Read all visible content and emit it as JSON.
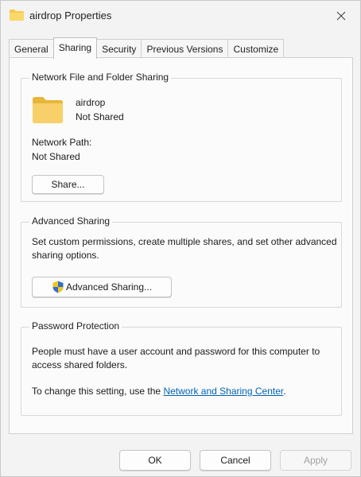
{
  "window": {
    "title": "airdrop Properties"
  },
  "tabs": [
    {
      "label": "General",
      "active": false
    },
    {
      "label": "Sharing",
      "active": true
    },
    {
      "label": "Security",
      "active": false
    },
    {
      "label": "Previous Versions",
      "active": false
    },
    {
      "label": "Customize",
      "active": false
    }
  ],
  "network_sharing": {
    "group_label": "Network File and Folder Sharing",
    "folder_name": "airdrop",
    "status": "Not Shared",
    "network_path_label": "Network Path:",
    "network_path_value": "Not Shared",
    "share_button": "Share..."
  },
  "advanced_sharing": {
    "group_label": "Advanced Sharing",
    "description": "Set custom permissions, create multiple shares, and set other advanced sharing options.",
    "button": "Advanced Sharing..."
  },
  "password_protection": {
    "group_label": "Password Protection",
    "description": "People must have a user account and password for this computer to access shared folders.",
    "change_text": "To change this setting, use the ",
    "link_text": "Network and Sharing Center",
    "change_suffix": "."
  },
  "buttons": {
    "ok": "OK",
    "cancel": "Cancel",
    "apply": "Apply"
  },
  "colors": {
    "folder": "#f6c94a",
    "link": "#0063b1",
    "shield_blue": "#2f6fd0",
    "shield_yellow": "#f5c518"
  },
  "icons": {
    "title_icon": "folder-icon",
    "folder_icon": "folder-icon",
    "close_icon": "close-icon",
    "shield_icon": "uac-shield-icon"
  }
}
